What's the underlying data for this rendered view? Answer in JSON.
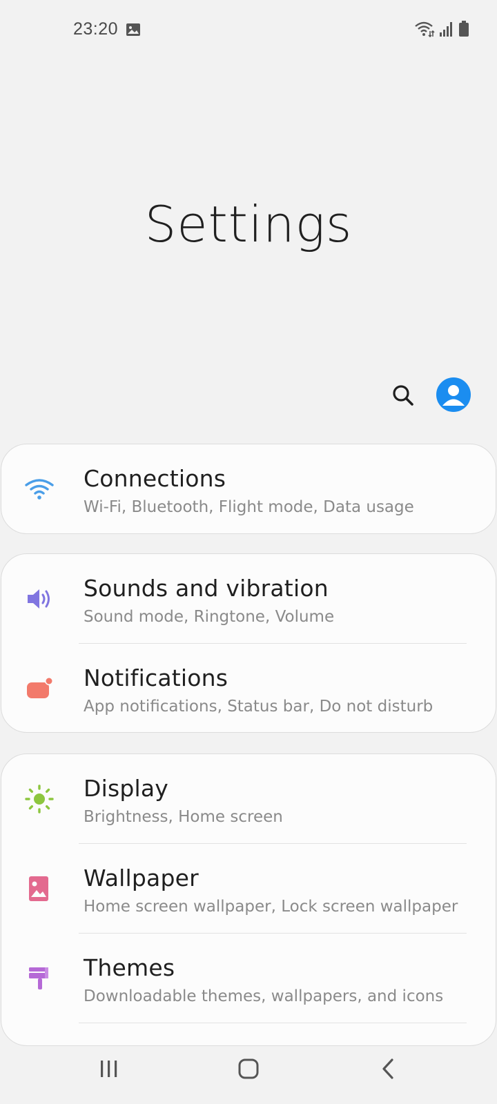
{
  "status_bar": {
    "time": "23:20",
    "icons": [
      "gallery-icon",
      "wifi-icon",
      "signal-icon",
      "battery-icon"
    ]
  },
  "header": {
    "title": "Settings"
  },
  "actions": {
    "search_icon": "search-icon",
    "profile_icon": "account-icon",
    "profile_color": "#1b8df0"
  },
  "groups": [
    {
      "items": [
        {
          "title": "Connections",
          "subtitle": "Wi-Fi, Bluetooth, Flight mode, Data usage",
          "icon": "wifi-icon",
          "color": "#4a9ee8"
        }
      ]
    },
    {
      "items": [
        {
          "title": "Sounds and vibration",
          "subtitle": "Sound mode, Ringtone, Volume",
          "icon": "speaker-icon",
          "color": "#8075e0"
        },
        {
          "title": "Notifications",
          "subtitle": "App notifications, Status bar, Do not disturb",
          "icon": "notification-icon",
          "color": "#f27a6b"
        }
      ]
    },
    {
      "items": [
        {
          "title": "Display",
          "subtitle": "Brightness, Home screen",
          "icon": "sun-icon",
          "color": "#8dc63f"
        },
        {
          "title": "Wallpaper",
          "subtitle": "Home screen wallpaper, Lock screen wallpaper",
          "icon": "picture-icon",
          "color": "#e36a8f"
        },
        {
          "title": "Themes",
          "subtitle": "Downloadable themes, wallpapers, and icons",
          "icon": "brush-icon",
          "color": "#b569d6"
        }
      ]
    }
  ],
  "nav_bar": {
    "recent_icon": "recent-apps-icon",
    "home_icon": "home-icon",
    "back_icon": "back-icon"
  }
}
